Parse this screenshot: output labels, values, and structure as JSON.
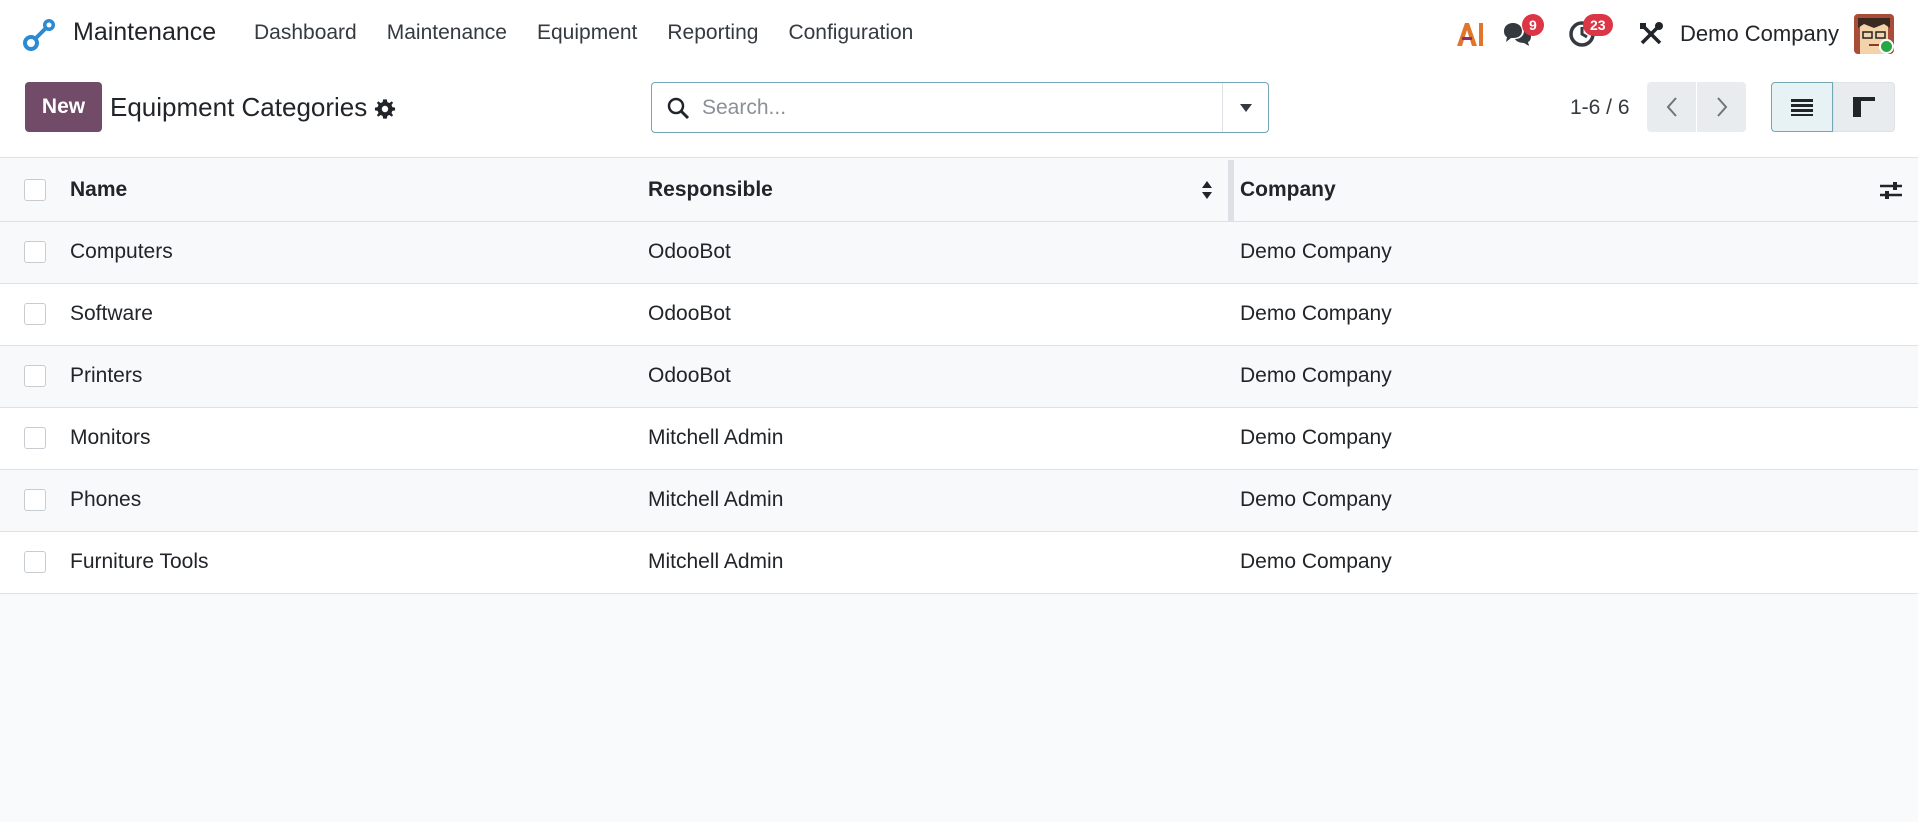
{
  "app": {
    "name": "Maintenance"
  },
  "menu": [
    "Dashboard",
    "Maintenance",
    "Equipment",
    "Reporting",
    "Configuration"
  ],
  "systray": {
    "messages_count": "9",
    "activities_count": "23",
    "company": "Demo Company"
  },
  "control": {
    "new_label": "New",
    "title": "Equipment Categories",
    "search_placeholder": "Search...",
    "pager": "1-6 / 6"
  },
  "table": {
    "headers": {
      "name": "Name",
      "responsible": "Responsible",
      "company": "Company"
    },
    "rows": [
      {
        "name": "Computers",
        "responsible": "OdooBot",
        "company": "Demo Company"
      },
      {
        "name": "Software",
        "responsible": "OdooBot",
        "company": "Demo Company"
      },
      {
        "name": "Printers",
        "responsible": "OdooBot",
        "company": "Demo Company"
      },
      {
        "name": "Monitors",
        "responsible": "Mitchell Admin",
        "company": "Demo Company"
      },
      {
        "name": "Phones",
        "responsible": "Mitchell Admin",
        "company": "Demo Company"
      },
      {
        "name": "Furniture Tools",
        "responsible": "Mitchell Admin",
        "company": "Demo Company"
      }
    ]
  },
  "colors": {
    "primary": "#714b67",
    "accent": "#017e84",
    "badge": "#dc3545"
  }
}
